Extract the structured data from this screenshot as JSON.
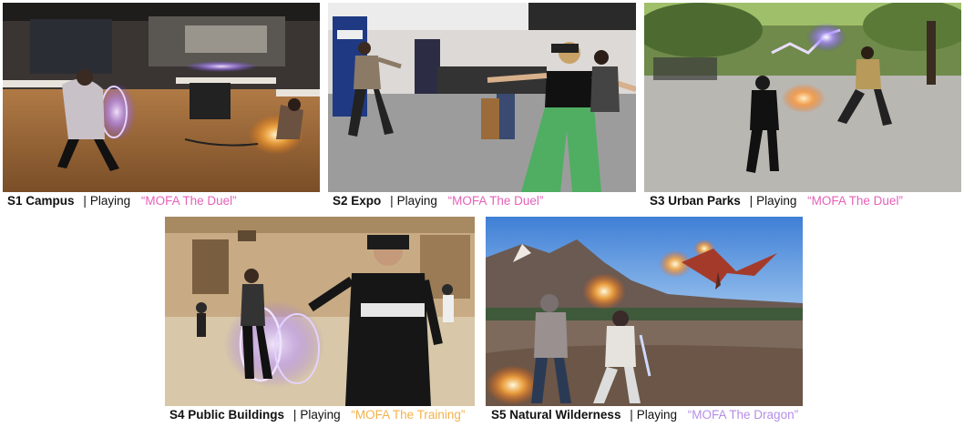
{
  "separator": "|",
  "playing_label": "Playing",
  "scenes": [
    {
      "id": "S1",
      "name": "Campus",
      "game": "“MOFA The Duel”",
      "game_color": "#e661b8"
    },
    {
      "id": "S2",
      "name": "Expo",
      "game": "“MOFA The Duel”",
      "game_color": "#e661b8"
    },
    {
      "id": "S3",
      "name": "Urban Parks",
      "game": "“MOFA The Duel”",
      "game_color": "#e661b8"
    },
    {
      "id": "S4",
      "name": "Public Buildings",
      "game": "“MOFA The Training”",
      "game_color": "#f3b24a"
    },
    {
      "id": "S5",
      "name": "Natural Wilderness",
      "game": "“MOFA The Dragon”",
      "game_color": "#b48ee6"
    }
  ]
}
